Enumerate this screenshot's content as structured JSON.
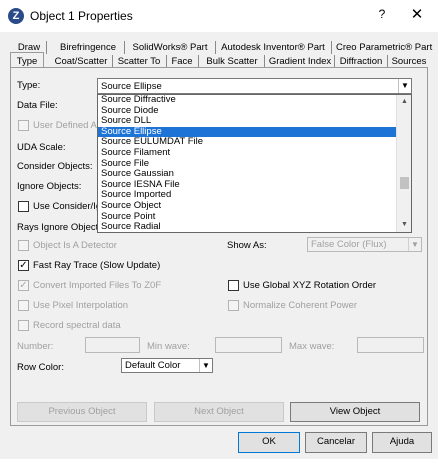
{
  "window": {
    "title": "Object 1 Properties",
    "help_label": "?",
    "close_label": "✕"
  },
  "tabs_row1": [
    "Draw",
    "Birefringence",
    "SolidWorks® Part",
    "Autodesk Inventor® Part",
    "Creo Parametric® Part"
  ],
  "tabs_row2": [
    "Type",
    "Coat/Scatter",
    "Scatter To",
    "Face",
    "Bulk Scatter",
    "Gradient Index",
    "Diffraction",
    "Sources"
  ],
  "form": {
    "type_label": "Type:",
    "type_value": "Source Ellipse",
    "data_file_label": "Data File:",
    "user_defined_label": "User Defined Ap",
    "uda_scale_label": "UDA Scale:",
    "consider_objects_label": "Consider Objects:",
    "ignore_objects_label": "Ignore Objects:",
    "use_consider_label": "Use Consider/Ig",
    "rays_ignore_label": "Rays Ignore Object:",
    "object_is_detector_label": "Object Is A Detector",
    "show_as_label": "Show As:",
    "show_as_value": "False Color (Flux)",
    "fast_ray_trace_label": "Fast Ray Trace (Slow Update)",
    "convert_imported_label": "Convert Imported Files To Z0F",
    "use_global_xyz_label": "Use Global XYZ Rotation Order",
    "use_pixel_interp_label": "Use Pixel Interpolation",
    "normalize_coherent_label": "Normalize Coherent Power",
    "record_spectral_label": "Record spectral data",
    "number_label": "Number:",
    "min_wave_label": "Min wave:",
    "max_wave_label": "Max wave:",
    "row_color_label": "Row Color:",
    "row_color_value": "Default Color",
    "checkbox_states": {
      "user_defined": false,
      "use_consider": false,
      "object_is_detector": false,
      "fast_ray_trace": true,
      "convert_imported": true,
      "use_global_xyz": false,
      "use_pixel_interp": false,
      "normalize_coherent": false,
      "record_spectral": false
    }
  },
  "dropdown": {
    "items": [
      "Source Diffractive",
      "Source Diode",
      "Source DLL",
      "Source Ellipse",
      "Source EULUMDAT File",
      "Source Filament",
      "Source File",
      "Source Gaussian",
      "Source IESNA File",
      "Source Imported",
      "Source Object",
      "Source Point",
      "Source Radial"
    ],
    "selected": "Source Ellipse"
  },
  "buttons": {
    "previous_object": "Previous Object",
    "next_object": "Next Object",
    "view_object": "View Object",
    "ok": "OK",
    "cancel": "Cancelar",
    "help": "Ajuda"
  },
  "colors": {
    "selection": "#1e73d7",
    "dialog_bg": "#f0f0f0",
    "icon_bg": "#2a4a8a"
  }
}
